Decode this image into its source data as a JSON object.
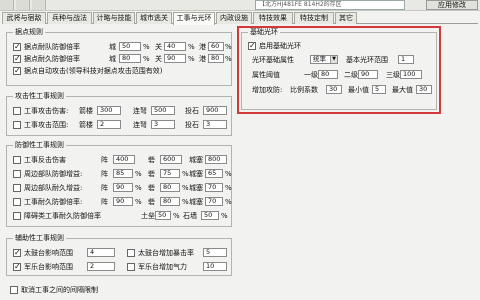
{
  "topbar": {
    "input_text": "【北方HJ481FE 814H2的存区",
    "apply_label": "应用修改"
  },
  "tabs": [
    "武将与宿敌",
    "兵种与战法",
    "计略与技能",
    "城市逃关",
    "工事与光环",
    "内政设施",
    "特技效果",
    "特技定制",
    "其它"
  ],
  "stronghold": {
    "title": "据点规则",
    "rows": [
      {
        "label": "据点耐队防御倍率",
        "a_label": "城",
        "a": "50",
        "b_label": "关",
        "b": "40",
        "c_label": "港",
        "c": "60",
        "unit": "%"
      },
      {
        "label": "据点耐久防御倍率",
        "a_label": "城",
        "a": "80",
        "b_label": "关",
        "b": "90",
        "c_label": "港",
        "c": "80",
        "unit": "%"
      },
      {
        "label": "据点自动攻击(领导科技对据点攻击范围有效)"
      }
    ]
  },
  "attack": {
    "title": "攻击性工事规则",
    "rows": [
      {
        "label": "工事攻击伤害:",
        "f1_label": "箭楼",
        "f1": "300",
        "f2_label": "连弩",
        "f2": "500",
        "f3_label": "投石",
        "f3": "900"
      },
      {
        "label": "工事攻击范围:",
        "f1_label": "箭楼",
        "f1": "2",
        "f2_label": "连弩",
        "f2": "3",
        "f3_label": "投石",
        "f3": "3"
      }
    ]
  },
  "defense": {
    "title": "防御性工事规则",
    "rows": [
      {
        "label": "工事反击伤害",
        "f1_label": "阵",
        "f1": "400",
        "f2_label": "砦",
        "f2": "600",
        "f3_label": "城塞",
        "f3": "800",
        "unit": ""
      },
      {
        "label": "周边部队防御增益:",
        "f1_label": "阵",
        "f1": "85",
        "f2_label": "砦",
        "f2": "75",
        "f3_label": "城塞",
        "f3": "65",
        "unit": "%"
      },
      {
        "label": "周边部队耐久增益:",
        "f1_label": "阵",
        "f1": "90",
        "f2_label": "砦",
        "f2": "80",
        "f3_label": "城塞",
        "f3": "70",
        "unit": "%"
      },
      {
        "label": "工事耐久防御倍率:",
        "f1_label": "阵",
        "f1": "90",
        "f2_label": "砦",
        "f2": "80",
        "f3_label": "城塞",
        "f3": "70",
        "unit": "%"
      },
      {
        "label": "障碍类工事耐久防御倍率",
        "f1_label": "土垒",
        "f1": "50",
        "f2_label": "石墙",
        "f2": "50",
        "unit": "%"
      }
    ]
  },
  "support": {
    "title": "辅助性工事规则",
    "rows": [
      {
        "left_label": "太鼓台影响范围",
        "left": "4",
        "right_label": "太鼓台增加暴击率",
        "right": "5"
      },
      {
        "left_label": "军乐台影响范围",
        "left": "2",
        "right_label": "军乐台增加气力",
        "right": "10"
      }
    ]
  },
  "bottom": {
    "label": "取消工事之间的间隔限制"
  },
  "aura": {
    "title": "基础光环",
    "enable_label": "启用基础光环",
    "prop_label": "光环基础属性",
    "prop_value": "统率",
    "base_range_label": "基本光环范围",
    "base_range": "1",
    "threshold_label": "属性阈值",
    "thresholds": [
      {
        "label": "一级",
        "value": "80"
      },
      {
        "label": "二级",
        "value": "90"
      },
      {
        "label": "三级",
        "value": "100"
      }
    ],
    "bonus_label": "增加攻防:",
    "ratio_label": "比例系数",
    "ratio": "30",
    "min_label": "最小值",
    "min": "5",
    "max_label": "最大值",
    "max": "30"
  }
}
